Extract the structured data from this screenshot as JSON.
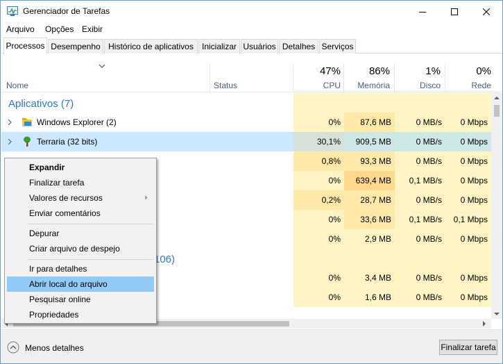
{
  "window": {
    "title": "Gerenciador de Tarefas"
  },
  "menu": [
    "Arquivo",
    "Opções",
    "Exibir"
  ],
  "tabs": [
    "Processos",
    "Desempenho",
    "Histórico de aplicativos",
    "Inicializar",
    "Usuários",
    "Detalhes",
    "Serviços"
  ],
  "columns": {
    "name": "Nome",
    "status": "Status",
    "cpu_pct": "47%",
    "cpu": "CPU",
    "mem_pct": "86%",
    "mem": "Memória",
    "disk_pct": "1%",
    "disk": "Disco",
    "net_pct": "0%",
    "net": "Rede"
  },
  "groups": {
    "apps": "Aplicativos (7)",
    "bg_partial": "106)"
  },
  "rows": [
    {
      "name": "Windows Explorer (2)",
      "cpu": "0%",
      "mem": "87,6 MB",
      "disk": "0 MB/s",
      "net": "0 Mbps"
    },
    {
      "name": "Terraria (32 bits)",
      "cpu": "30,1%",
      "mem": "909,5 MB",
      "disk": "0 MB/s",
      "net": "0 Mbps"
    },
    {
      "cpu": "0,8%",
      "mem": "93,3 MB",
      "disk": "0 MB/s",
      "net": "0 Mbps"
    },
    {
      "cpu": "0%",
      "mem": "639,4 MB",
      "disk": "0,1 MB/s",
      "net": "0 Mbps"
    },
    {
      "cpu": "0,2%",
      "mem": "28,7 MB",
      "disk": "0 MB/s",
      "net": "0 Mbps"
    },
    {
      "cpu": "0%",
      "mem": "33,6 MB",
      "disk": "0,1 MB/s",
      "net": "0,1 Mbps"
    },
    {
      "cpu": "0%",
      "mem": "2,9 MB",
      "disk": "0 MB/s",
      "net": "0 Mbps"
    },
    {
      "cpu": "0%",
      "mem": "3,4 MB",
      "disk": "0 MB/s",
      "net": "0 Mbps"
    },
    {
      "cpu": "0%",
      "mem": "1,6 MB",
      "disk": "0 MB/s",
      "net": "0 Mbps"
    }
  ],
  "context_menu": [
    "Expandir",
    "Finalizar tarefa",
    "Valores de recursos",
    "Enviar comentários",
    "Depurar",
    "Criar arquivo de despejo",
    "Ir para detalhes",
    "Abrir local do arquivo",
    "Pesquisar online",
    "Propriedades"
  ],
  "footer": {
    "less_details": "Menos detalhes",
    "end_task": "Finalizar tarefa"
  },
  "colors": {
    "group_blue": "#2b77d4",
    "heat_light": "#fff4c4",
    "heat_mid": "#ffe8a8",
    "heat_strong": "#ffd98c",
    "selected_row": "#cce8ff",
    "menu_highlight": "#91c9f7"
  },
  "icons": [
    "task-manager-icon",
    "minimize-icon",
    "maximize-icon",
    "close-icon",
    "chevron-down-icon",
    "chevron-right-icon",
    "folder-icon",
    "terraria-tree-icon",
    "chevron-up-circle-icon",
    "submenu-arrow-icon"
  ]
}
